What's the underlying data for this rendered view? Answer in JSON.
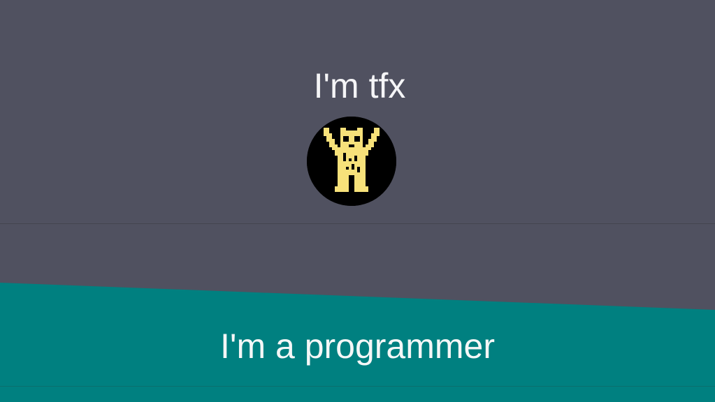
{
  "hero": {
    "title": "I'm tfx",
    "avatar_icon": "pixel-character-icon"
  },
  "tagline": {
    "text": "I'm a programmer"
  },
  "colors": {
    "background": "#505160",
    "accent_band": "#008080",
    "avatar_bg": "#000000",
    "avatar_figure": "#f7e17a",
    "text": "#f5f5f7"
  }
}
